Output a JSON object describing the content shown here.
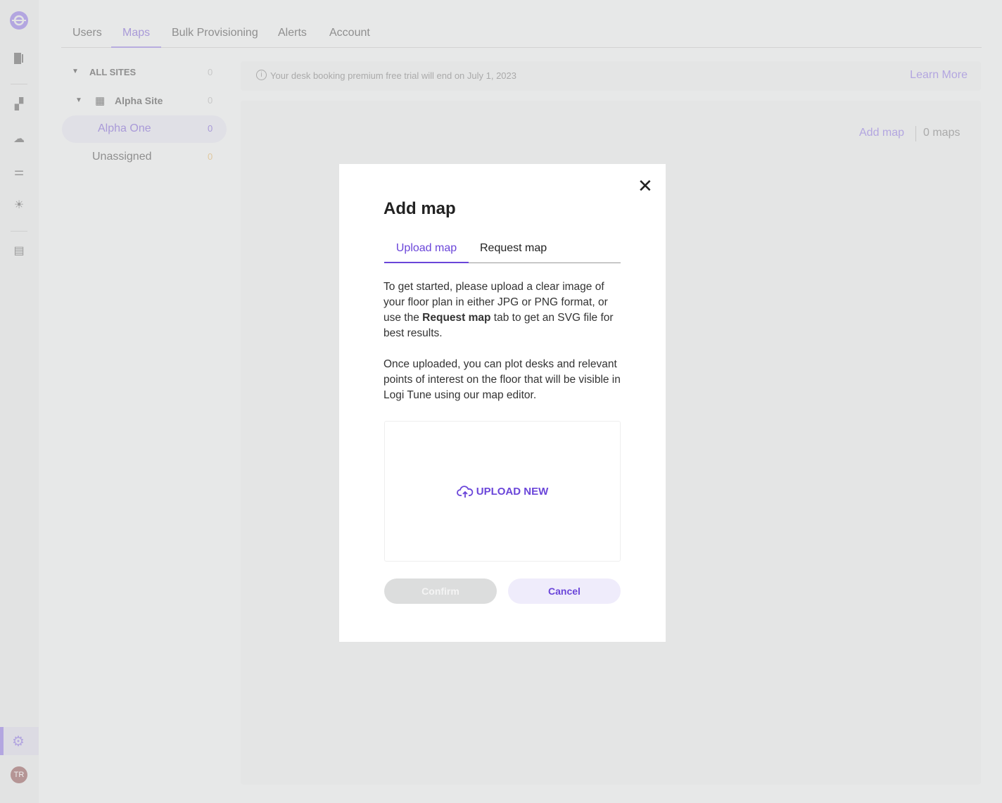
{
  "nav": {
    "tabs": [
      "Users",
      "Maps",
      "Bulk Provisioning",
      "Alerts",
      "Account"
    ],
    "active": "Maps"
  },
  "sidebar": {
    "avatar": "TR"
  },
  "tree": {
    "all_sites": "ALL SITES",
    "all_count": "0",
    "site": "Alpha Site",
    "site_count": "0",
    "floor": "Alpha One",
    "floor_count": "0",
    "unassigned": "Unassigned",
    "unassigned_count": "0"
  },
  "banner": {
    "text": "Your desk booking premium free trial will end on July 1, 2023",
    "link": "Learn More"
  },
  "panel": {
    "add_map": "Add map",
    "count": "0 maps"
  },
  "modal": {
    "title": "Add map",
    "tabs": [
      "Upload map",
      "Request map"
    ],
    "p1a": "To get started, please upload a clear image of your floor plan in either JPG or PNG format, or use the ",
    "p1b": "Request map",
    "p1c": " tab to get an SVG file for best results.",
    "p2": "Once uploaded, you can plot desks and relevant points of interest on the floor that will be visible in Logi Tune using our map editor.",
    "upload": "UPLOAD NEW",
    "confirm": "Confirm",
    "cancel": "Cancel"
  },
  "colors": {
    "accent": "#6a45d9",
    "accent_dim": "#a99ad8"
  }
}
